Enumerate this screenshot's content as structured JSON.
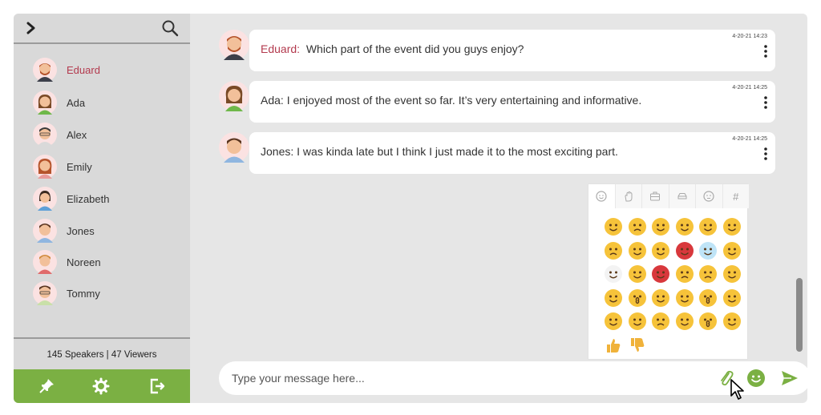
{
  "sidebar": {
    "users": [
      {
        "name": "Eduard",
        "active": true
      },
      {
        "name": "Ada"
      },
      {
        "name": "Alex"
      },
      {
        "name": "Emily"
      },
      {
        "name": "Elizabeth"
      },
      {
        "name": "Jones"
      },
      {
        "name": "Noreen"
      },
      {
        "name": "Tommy"
      }
    ],
    "stats": "145 Speakers | 47 Viewers",
    "toolbar_color": "#7bb043"
  },
  "messages": [
    {
      "author": "Eduard:",
      "text": "Which part of the event did you guys enjoy?",
      "time": "4-20-21 14:23"
    },
    {
      "author": "",
      "text": "Ada: I enjoyed most of the event so far. It’s very entertaining and informative.",
      "time": "4-20-21 14:25"
    },
    {
      "author": "",
      "text": "Jones:  I was kinda late but I think I just made it to the most exciting part.",
      "time": "4-20-21 14:25"
    }
  ],
  "emoji_picker": {
    "tabs": [
      "smiley-icon",
      "hand-icon",
      "briefcase-icon",
      "car-icon",
      "face-icon",
      "hash-icon"
    ],
    "hash_label": "#"
  },
  "composer": {
    "placeholder": "Type your message here..."
  },
  "colors": {
    "accent": "#7bb043",
    "author": "#b33a4e"
  }
}
